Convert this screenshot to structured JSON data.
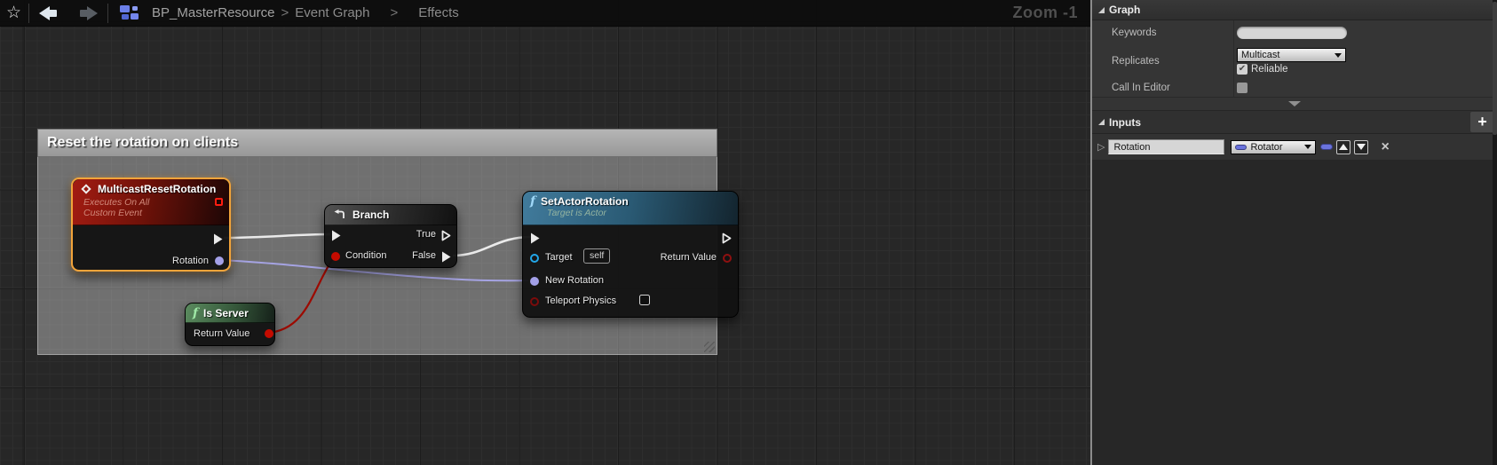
{
  "toolbar": {
    "favorite_icon": "☆",
    "breadcrumb": {
      "separator": ">",
      "items": [
        "BP_MasterResource",
        "Event Graph",
        "Effects"
      ]
    }
  },
  "graph": {
    "zoom_label": "Zoom -1",
    "comment": {
      "title": "Reset the rotation on clients"
    },
    "nodes": {
      "event": {
        "title": "MulticastResetRotation",
        "subtitle_line1": "Executes On All",
        "subtitle_line2": "Custom Event",
        "output_pin_label": "Rotation"
      },
      "branch": {
        "title": "Branch",
        "condition_label": "Condition",
        "true_label": "True",
        "false_label": "False"
      },
      "set_actor_rotation": {
        "title": "SetActorRotation",
        "subtitle": "Target is Actor",
        "target_label": "Target",
        "target_value": "self",
        "return_label": "Return Value",
        "new_rotation_label": "New Rotation",
        "teleport_label": "Teleport Physics"
      },
      "is_server": {
        "title": "Is Server",
        "return_label": "Return Value"
      }
    },
    "colors": {
      "exec_wire": "#eaeaea",
      "rotator_wire": "#a5a3e2",
      "condition_wire": "#9c0a00",
      "selection_orange": "#f2a43a",
      "rotator_pin": "#a3a0e8",
      "bool_pin": "#c40b00",
      "object_pin": "#22a6e8"
    }
  },
  "details_panel": {
    "graph_section": {
      "title": "Graph",
      "keywords_label": "Keywords",
      "keywords_value": "",
      "replicates_label": "Replicates",
      "replicates_value": "Multicast",
      "reliable_label": "Reliable",
      "reliable_checked": true,
      "call_in_editor_label": "Call In Editor",
      "call_in_editor_checked": false
    },
    "inputs_section": {
      "title": "Inputs",
      "add_button": "+",
      "rows": [
        {
          "name": "Rotation",
          "type": "Rotator"
        }
      ]
    }
  },
  "icons": {
    "check": "✔",
    "close": "×",
    "expander_right": "▷"
  }
}
